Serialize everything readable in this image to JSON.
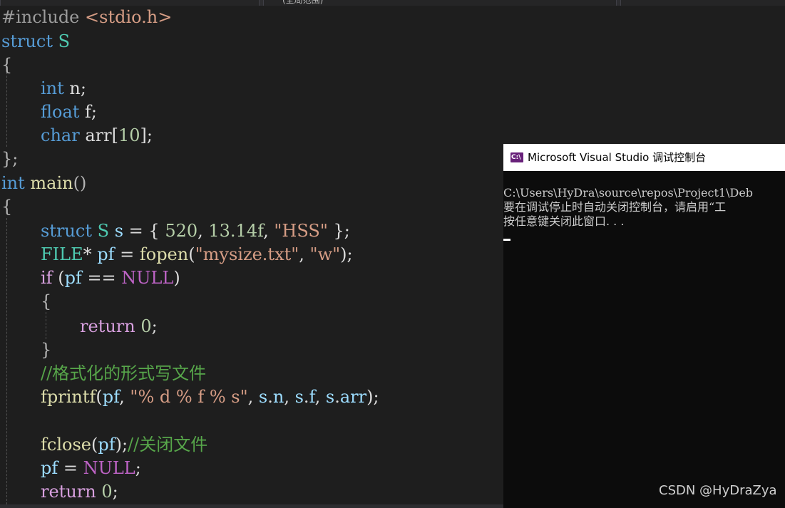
{
  "tabs": [
    {
      "label": ""
    },
    {
      "label": "(全局范围)"
    },
    {
      "label": ""
    }
  ],
  "code": {
    "lines": [
      [
        "#include ",
        "<stdio.h>"
      ],
      [
        "struct",
        " ",
        "S"
      ],
      [
        "{"
      ],
      [
        "int",
        " n;"
      ],
      [
        "float",
        " f;"
      ],
      [
        "char",
        " arr[",
        "10",
        "];"
      ],
      [
        "};"
      ],
      [
        "int",
        " ",
        "main",
        "()"
      ],
      [
        "{"
      ],
      [
        "struct",
        " ",
        "S",
        " ",
        "s",
        " = { ",
        "520",
        ", ",
        "13.14f",
        ", ",
        "\"HSS\"",
        " };"
      ],
      [
        "FILE",
        "* ",
        "pf",
        " = ",
        "fopen",
        "(",
        "\"mysize.txt\"",
        ", ",
        "\"w\"",
        ");"
      ],
      [
        "if",
        " (",
        "pf",
        " == ",
        "NULL",
        ")"
      ],
      [
        "{"
      ],
      [
        "return",
        " ",
        "0",
        ";"
      ],
      [
        "}"
      ],
      [
        "//格式化的形式写文件"
      ],
      [
        "fprintf",
        "(",
        "pf",
        ", ",
        "\"% d % f % s\"",
        ", ",
        "s",
        ".",
        "n",
        ", ",
        "s",
        ".",
        "f",
        ", ",
        "s",
        ".",
        "arr",
        ");"
      ],
      [
        ""
      ],
      [
        "fclose",
        "(",
        "pf",
        ");",
        "//关闭文件"
      ],
      [
        "pf",
        " = ",
        "NULL",
        ";"
      ],
      [
        "return",
        " ",
        "0",
        ";"
      ]
    ]
  },
  "console": {
    "title": "Microsoft Visual Studio 调试控制台",
    "icon_text": "C:\\",
    "lines": [
      "C:\\Users\\HyDra\\source\\repos\\Project1\\Deb",
      "要在调试停止时自动关闭控制台，请启用“工",
      "按任意键关闭此窗口. . ."
    ]
  },
  "watermark": "CSDN @HyDraZya",
  "colors": {
    "editor_bg": "#1e1e1e",
    "keyword": "#569cd6",
    "control": "#d8a0df",
    "type": "#4ec9b0",
    "function": "#dcdcaa",
    "variable": "#9cdcfe",
    "number": "#b5cea8",
    "string": "#d69d85",
    "comment": "#57a64a",
    "console_bg": "#0c0c0c",
    "console_icon": "#68217a"
  }
}
